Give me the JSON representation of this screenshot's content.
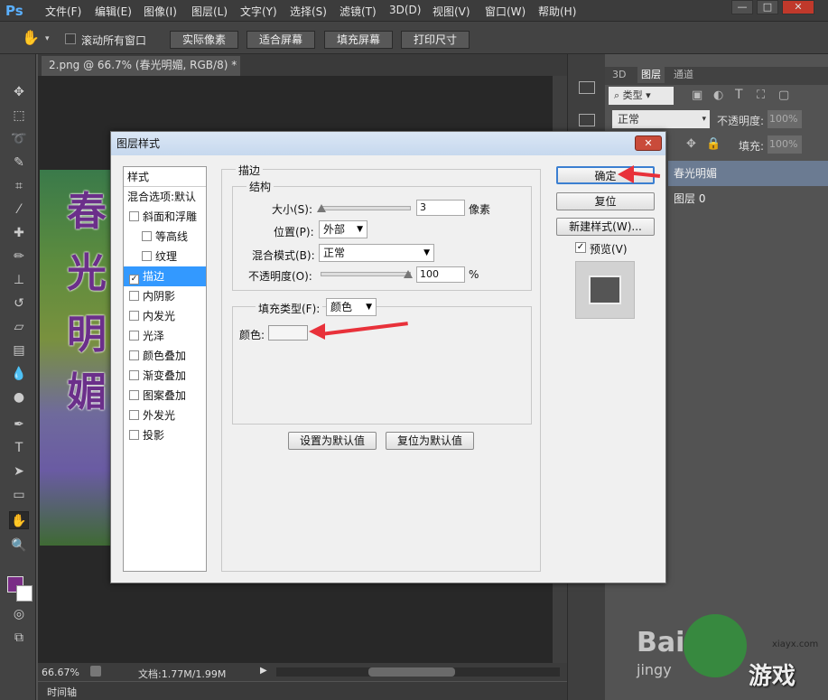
{
  "app": {
    "logo": "Ps"
  },
  "menu": [
    "文件(F)",
    "编辑(E)",
    "图像(I)",
    "图层(L)",
    "文字(Y)",
    "选择(S)",
    "滤镜(T)",
    "3D(D)",
    "视图(V)",
    "窗口(W)",
    "帮助(H)"
  ],
  "window_controls": [
    "—",
    "□",
    "✕"
  ],
  "options": {
    "scroll_all_label": "滚动所有窗口",
    "buttons": [
      "实际像素",
      "适合屏幕",
      "填充屏幕",
      "打印尺寸"
    ]
  },
  "document": {
    "tab_title": "2.png @ 66.7% (春光明媚, RGB/8) *",
    "image_text": [
      "春",
      "光",
      "明",
      "媚"
    ]
  },
  "status": {
    "zoom": "66.67%",
    "doc_info": "文档:1.77M/1.99M"
  },
  "timeline_label": "时间轴",
  "layers_panel": {
    "tabs": [
      "3D",
      "图层",
      "通道"
    ],
    "filter_kind": "类型",
    "blend_mode": "正常",
    "opacity_label": "不透明度:",
    "opacity_value": "100%",
    "fill_label": "填充:",
    "fill_value": "100%",
    "layers": [
      "春光明媚",
      "图层 0"
    ]
  },
  "dialog": {
    "title": "图层样式",
    "close_icon": "✕",
    "style_list": [
      {
        "label": "样式",
        "checkbox": false
      },
      {
        "label": "混合选项:默认",
        "checkbox": false
      },
      {
        "label": "斜面和浮雕",
        "checkbox": true,
        "checked": false
      },
      {
        "label": "等高线",
        "checkbox": true,
        "checked": false,
        "indent": true
      },
      {
        "label": "纹理",
        "checkbox": true,
        "checked": false,
        "indent": true
      },
      {
        "label": "描边",
        "checkbox": true,
        "checked": true,
        "selected": true
      },
      {
        "label": "内阴影",
        "checkbox": true,
        "checked": false
      },
      {
        "label": "内发光",
        "checkbox": true,
        "checked": false
      },
      {
        "label": "光泽",
        "checkbox": true,
        "checked": false
      },
      {
        "label": "颜色叠加",
        "checkbox": true,
        "checked": false
      },
      {
        "label": "渐变叠加",
        "checkbox": true,
        "checked": false
      },
      {
        "label": "图案叠加",
        "checkbox": true,
        "checked": false
      },
      {
        "label": "外发光",
        "checkbox": true,
        "checked": false
      },
      {
        "label": "投影",
        "checkbox": true,
        "checked": false
      }
    ],
    "stroke": {
      "group_title": "描边",
      "structure_title": "结构",
      "size_label": "大小(S):",
      "size_value": "3",
      "size_unit": "像素",
      "position_label": "位置(P):",
      "position_value": "外部",
      "blend_label": "混合模式(B):",
      "blend_value": "正常",
      "opacity_label": "不透明度(O):",
      "opacity_value": "100",
      "opacity_unit": "%",
      "fill_type_label": "填充类型(F):",
      "fill_type_value": "颜色",
      "color_label": "颜色:",
      "color_value": "#f5f5f5"
    },
    "buttons": {
      "make_default": "设置为默认值",
      "reset_default": "复位为默认值",
      "ok": "确定",
      "reset": "复位",
      "new_style": "新建样式(W)...",
      "preview": "预览(V)"
    }
  },
  "watermark": {
    "text1": "Bai",
    "text2": "jingy",
    "text3": "游戏",
    "text4": "xiayx.com"
  },
  "colors": {
    "accent_red": "#e8313a",
    "foreground": "#7a2d86",
    "background": "#ffffff"
  }
}
